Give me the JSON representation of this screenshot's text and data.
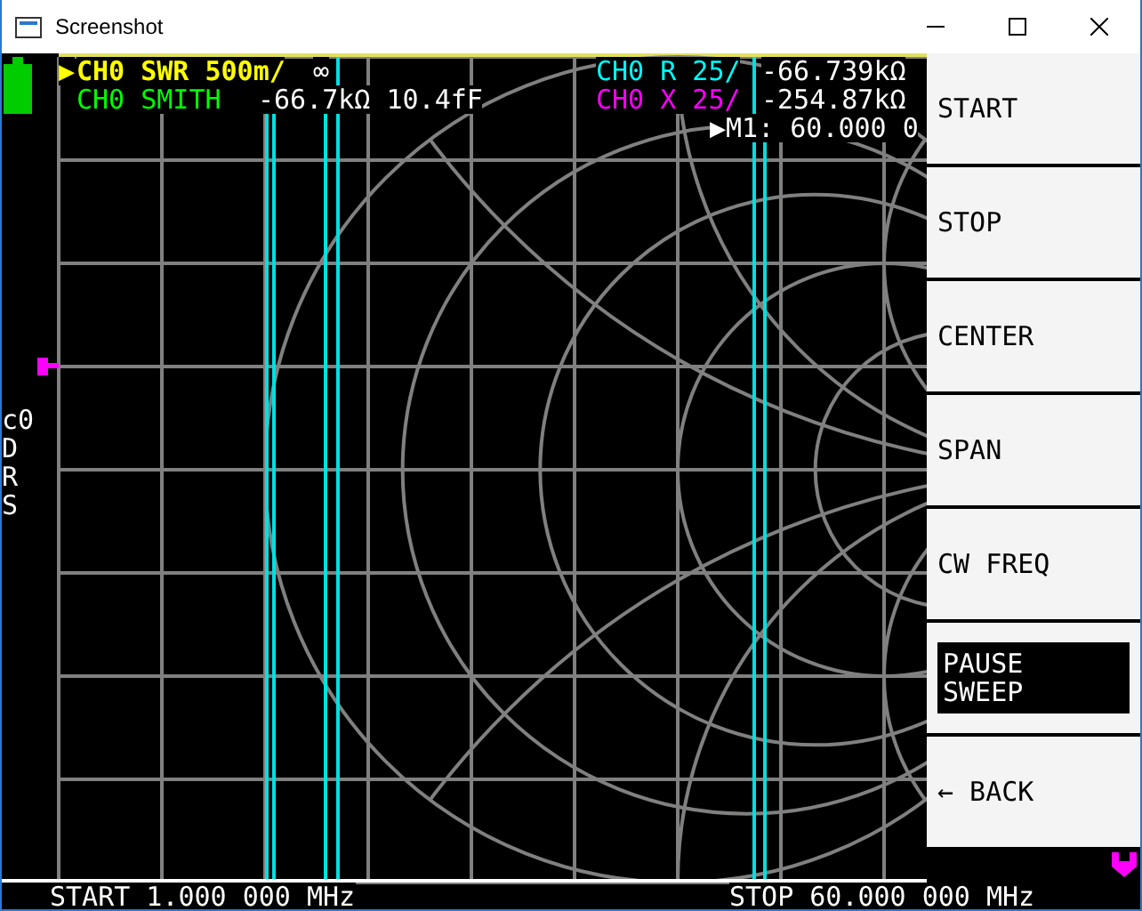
{
  "window": {
    "title": "Screenshot"
  },
  "active_marker": "▶",
  "traces": [
    {
      "selected": true,
      "label": "CH0 SWR 500m/",
      "value": "∞",
      "color": "#ffff00"
    },
    {
      "selected": false,
      "label": "CH0 SMITH",
      "value": "-66.7kΩ 10.4fF",
      "color": "#00ff00"
    },
    {
      "selected": false,
      "label": "CH0 R 25/",
      "value": "-66.739kΩ",
      "color": "#00ffff"
    },
    {
      "selected": false,
      "label": "CH0 X 25/",
      "value": "-254.87kΩ",
      "color": "#ff00ff"
    }
  ],
  "marker_readout": "▶M1: 60.000 0",
  "status": [
    "c0",
    "D",
    "R",
    "S"
  ],
  "sweep": {
    "start": "START 1.000 000 MHz",
    "stop": "STOP 60.000 000 MHz"
  },
  "menu": [
    {
      "label": "START",
      "selected": false
    },
    {
      "label": "STOP",
      "selected": false
    },
    {
      "label": "CENTER",
      "selected": false
    },
    {
      "label": "SPAN",
      "selected": false
    },
    {
      "label": "CW FREQ",
      "selected": false
    },
    {
      "label": "PAUSE\nSWEEP",
      "selected": true
    },
    {
      "label": "← BACK",
      "selected": false
    }
  ]
}
